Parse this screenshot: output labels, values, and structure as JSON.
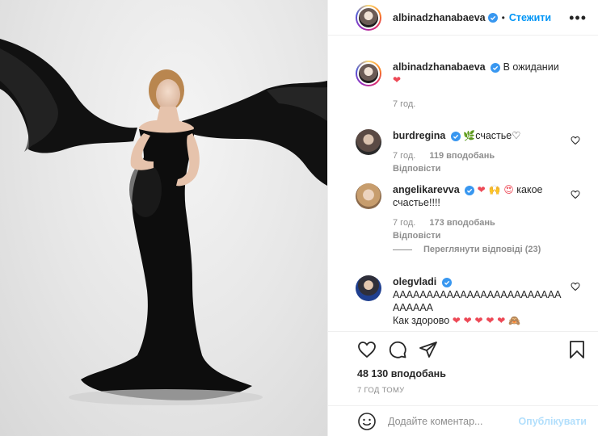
{
  "post": {
    "author": "albinadzhanabaeva",
    "follow_label": "Стежити",
    "dot": "•",
    "more_label": "•••",
    "caption": {
      "username": "albinadzhanabaeva",
      "text": "В ожидании",
      "emoji": "❤",
      "time": "7 год."
    },
    "comments": [
      {
        "username": "burdregina",
        "text": "счастье♡",
        "emoji": "🌿",
        "time": "7 год.",
        "likes": "119 вподобань",
        "reply": "Відповісти"
      },
      {
        "username": "angelikarevva",
        "emoji": "❤ 🙌 😍",
        "text": "какое счастье!!!!",
        "time": "7 год.",
        "likes": "173 вподобань",
        "reply": "Відповісти",
        "view_replies": "Переглянути відповіді (23)"
      },
      {
        "username": "olegvladi",
        "text_line1": "ААААААААААААААААААААААААААААААА",
        "text_line2": "Как здорово",
        "emoji": "❤ ❤ ❤ ❤ ❤ 🙈"
      }
    ],
    "likes_total": "48 130 вподобань",
    "time_ago": "7 ГОД ТОМУ",
    "comment_placeholder": "Додайте коментар...",
    "publish_label": "Опублікувати"
  },
  "colors": {
    "accent": "#0095f6",
    "verified": "#3897f0",
    "heart": "#ed4956",
    "muted": "#8e8e8e",
    "publish_disabled": "#b2dffc"
  },
  "icons": [
    "verified-badge-icon",
    "more-options-icon",
    "heart-outline-icon",
    "comment-icon",
    "share-icon",
    "bookmark-icon",
    "emoji-icon"
  ]
}
